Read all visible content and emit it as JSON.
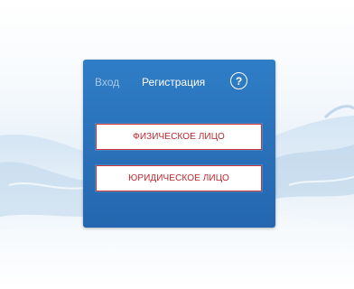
{
  "tabs": {
    "login_label": "Вход",
    "register_label": "Регистрация",
    "help_label": "?"
  },
  "buttons": {
    "individual_label": "ФИЗИЧЕСКОЕ ЛИЦО",
    "legal_entity_label": "ЮРИДИЧЕСКОЕ ЛИЦО"
  },
  "colors": {
    "card_blue": "#2a72bb",
    "button_border_red": "#c9383d",
    "button_text_red": "#c0282e",
    "inactive_tab": "#aac9e8"
  }
}
